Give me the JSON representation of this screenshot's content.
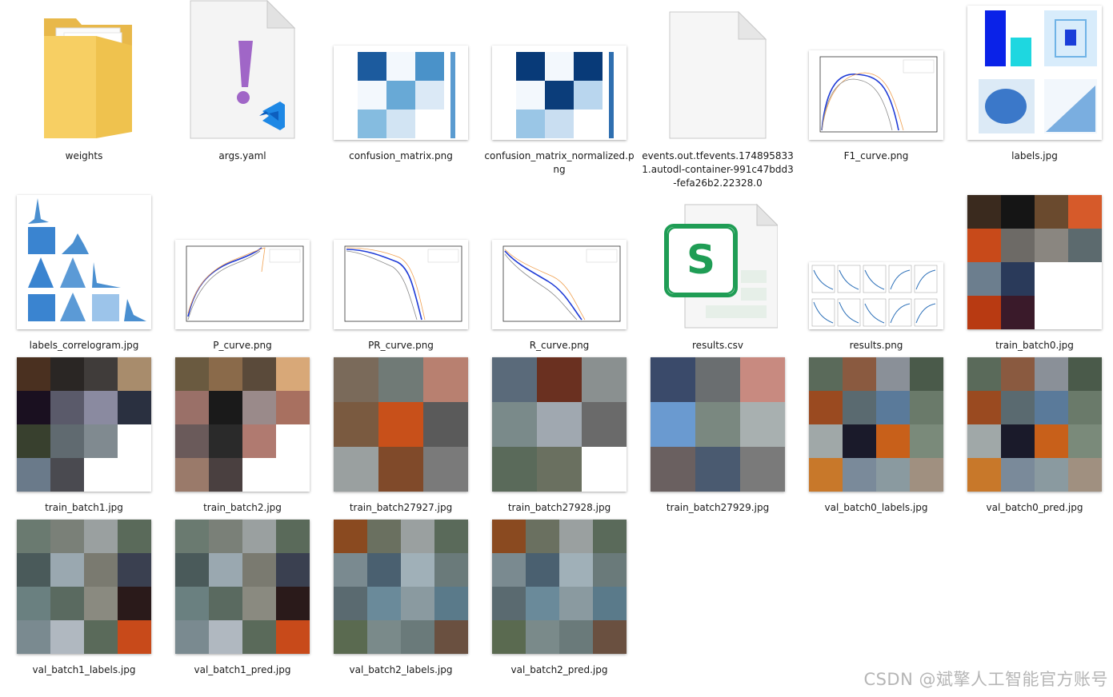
{
  "files": [
    {
      "label": "weights",
      "kind": "folder"
    },
    {
      "label": "args.yaml",
      "kind": "yaml"
    },
    {
      "label": "confusion_matrix.png",
      "kind": "cm"
    },
    {
      "label": "confusion_matrix_normalized.png",
      "kind": "cm"
    },
    {
      "label": "events.out.tfevents.1748958331.autodl-container-991c47bdd3-fefa26b2.22328.0",
      "kind": "blank"
    },
    {
      "label": "F1_curve.png",
      "kind": "curve"
    },
    {
      "label": "labels.jpg",
      "kind": "labels"
    },
    {
      "label": "labels_correlogram.jpg",
      "kind": "corr"
    },
    {
      "label": "P_curve.png",
      "kind": "curve"
    },
    {
      "label": "PR_curve.png",
      "kind": "curve"
    },
    {
      "label": "R_curve.png",
      "kind": "curve"
    },
    {
      "label": "results.csv",
      "kind": "csv"
    },
    {
      "label": "results.png",
      "kind": "results"
    },
    {
      "label": "train_batch0.jpg",
      "kind": "photo"
    },
    {
      "label": "train_batch1.jpg",
      "kind": "photo"
    },
    {
      "label": "train_batch2.jpg",
      "kind": "photo"
    },
    {
      "label": "train_batch27927.jpg",
      "kind": "photo"
    },
    {
      "label": "train_batch27928.jpg",
      "kind": "photo"
    },
    {
      "label": "train_batch27929.jpg",
      "kind": "photo"
    },
    {
      "label": "val_batch0_labels.jpg",
      "kind": "photo"
    },
    {
      "label": "val_batch0_pred.jpg",
      "kind": "photo"
    },
    {
      "label": "val_batch1_labels.jpg",
      "kind": "photo"
    },
    {
      "label": "val_batch1_pred.jpg",
      "kind": "photo"
    },
    {
      "label": "val_batch2_labels.jpg",
      "kind": "photo"
    },
    {
      "label": "val_batch2_pred.jpg",
      "kind": "photo"
    }
  ],
  "watermark": "CSDN @斌擎人工智能官方账号",
  "colors": {
    "folder": "#f5c84c",
    "vscode": "#1e88e5",
    "yaml_mark": "#a066c7",
    "csv_green": "#1f9d55",
    "cm_dark": "#0b3d7a",
    "curve_blue": "#1f3bd6"
  }
}
